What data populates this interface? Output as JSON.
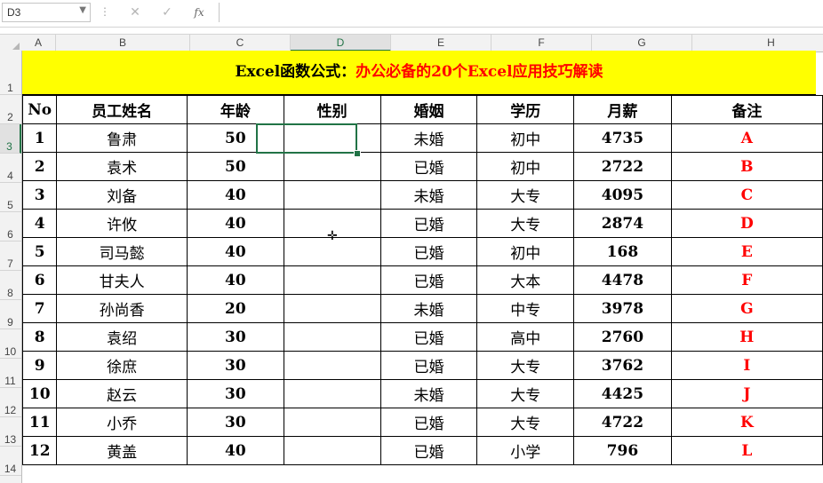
{
  "formula_bar": {
    "name_box": "D3",
    "formula": ""
  },
  "icons": {
    "name_box_dropdown": "chevron-down-icon",
    "cancel": "close-icon",
    "enter": "check-icon",
    "insert_function": "fx-icon"
  },
  "formula_buttons": {
    "cancel": "✕",
    "enter": "✓",
    "fx": "fx"
  },
  "columns": [
    "A",
    "B",
    "C",
    "D",
    "E",
    "F",
    "G",
    "H"
  ],
  "rows": [
    "1",
    "2",
    "3",
    "4",
    "5",
    "6",
    "7",
    "8",
    "9",
    "10",
    "11",
    "12",
    "13",
    "14"
  ],
  "selected_cell": {
    "column": "D",
    "row": "3"
  },
  "title": {
    "part1": "Excel函数公式：",
    "part2": "办公必备的20个Excel应用技巧解读"
  },
  "headers": [
    "No",
    "员工姓名",
    "年龄",
    "性别",
    "婚姻",
    "学历",
    "月薪",
    "备注"
  ],
  "records": [
    [
      "1",
      "鲁肃",
      "50",
      "",
      "未婚",
      "初中",
      "4735",
      "A"
    ],
    [
      "2",
      "袁术",
      "50",
      "",
      "已婚",
      "初中",
      "2722",
      "B"
    ],
    [
      "3",
      "刘备",
      "40",
      "",
      "未婚",
      "大专",
      "4095",
      "C"
    ],
    [
      "4",
      "许攸",
      "40",
      "",
      "已婚",
      "大专",
      "2874",
      "D"
    ],
    [
      "5",
      "司马懿",
      "40",
      "",
      "已婚",
      "初中",
      "168",
      "E"
    ],
    [
      "6",
      "甘夫人",
      "40",
      "",
      "已婚",
      "大本",
      "4478",
      "F"
    ],
    [
      "7",
      "孙尚香",
      "20",
      "",
      "未婚",
      "中专",
      "3978",
      "G"
    ],
    [
      "8",
      "袁绍",
      "30",
      "",
      "已婚",
      "高中",
      "2760",
      "H"
    ],
    [
      "9",
      "徐庶",
      "30",
      "",
      "已婚",
      "大专",
      "3762",
      "I"
    ],
    [
      "10",
      "赵云",
      "30",
      "",
      "未婚",
      "大专",
      "4425",
      "J"
    ],
    [
      "11",
      "小乔",
      "30",
      "",
      "已婚",
      "大专",
      "4722",
      "K"
    ],
    [
      "12",
      "黄盖",
      "40",
      "",
      "已婚",
      "小学",
      "796",
      "L"
    ]
  ],
  "colors": {
    "title_bg": "#ffff00",
    "title_accent": "#ff0000",
    "note_text": "#ff0000",
    "selection": "#217346"
  }
}
